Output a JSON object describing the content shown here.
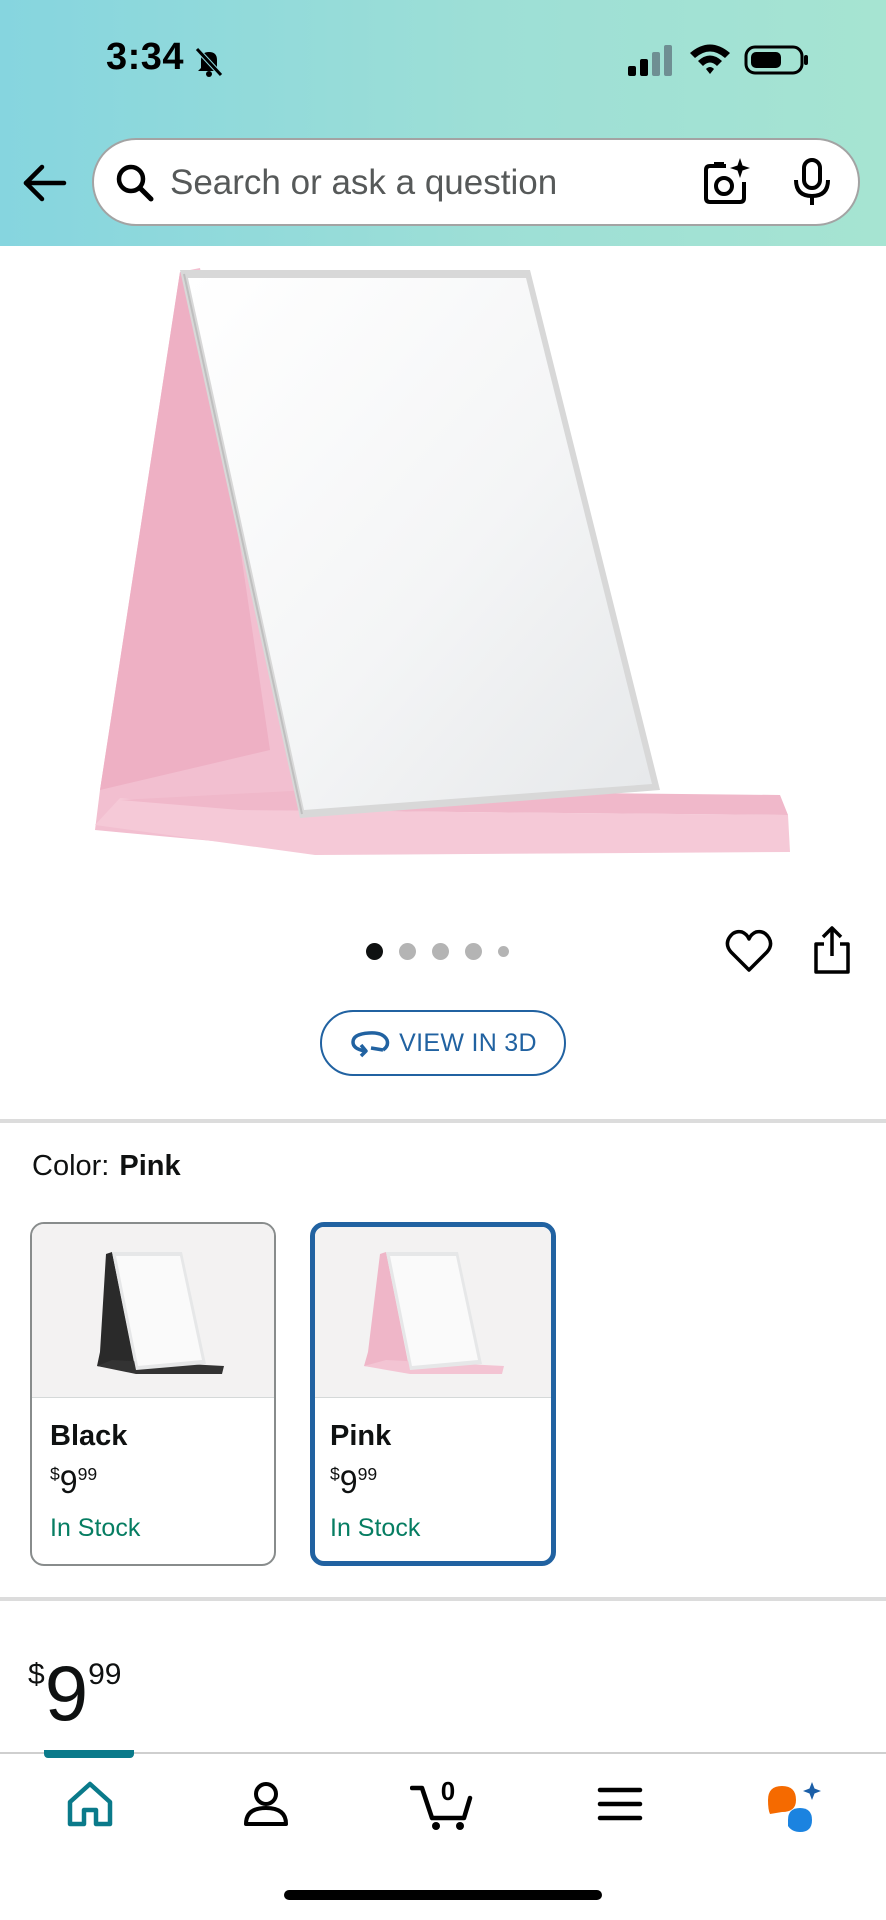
{
  "status_bar": {
    "time": "3:34"
  },
  "search": {
    "placeholder": "Search or ask a question"
  },
  "gallery": {
    "image_count": 5,
    "active_index": 0,
    "view_3d_label": "VIEW IN 3D"
  },
  "variation": {
    "label": "Color:",
    "selected": "Pink",
    "options": [
      {
        "name": "Black",
        "currency": "$",
        "whole": "9",
        "fraction": "99",
        "availability": "In Stock"
      },
      {
        "name": "Pink",
        "currency": "$",
        "whole": "9",
        "fraction": "99",
        "availability": "In Stock"
      }
    ]
  },
  "price": {
    "currency": "$",
    "whole": "9",
    "fraction": "99"
  },
  "cart": {
    "count": "0"
  },
  "colors": {
    "accent_blue": "#2162a1",
    "in_stock_green": "#067d62",
    "header_gradient_start": "#86d5df",
    "header_gradient_end": "#a6e4d2",
    "nav_active": "#0a7a8a"
  },
  "icons": [
    "bell-slash",
    "signal",
    "wifi",
    "battery",
    "back-arrow",
    "search",
    "camera-sparkle",
    "microphone",
    "heart",
    "share",
    "rotate-3d",
    "home",
    "account",
    "cart",
    "menu",
    "rufus-ai"
  ]
}
